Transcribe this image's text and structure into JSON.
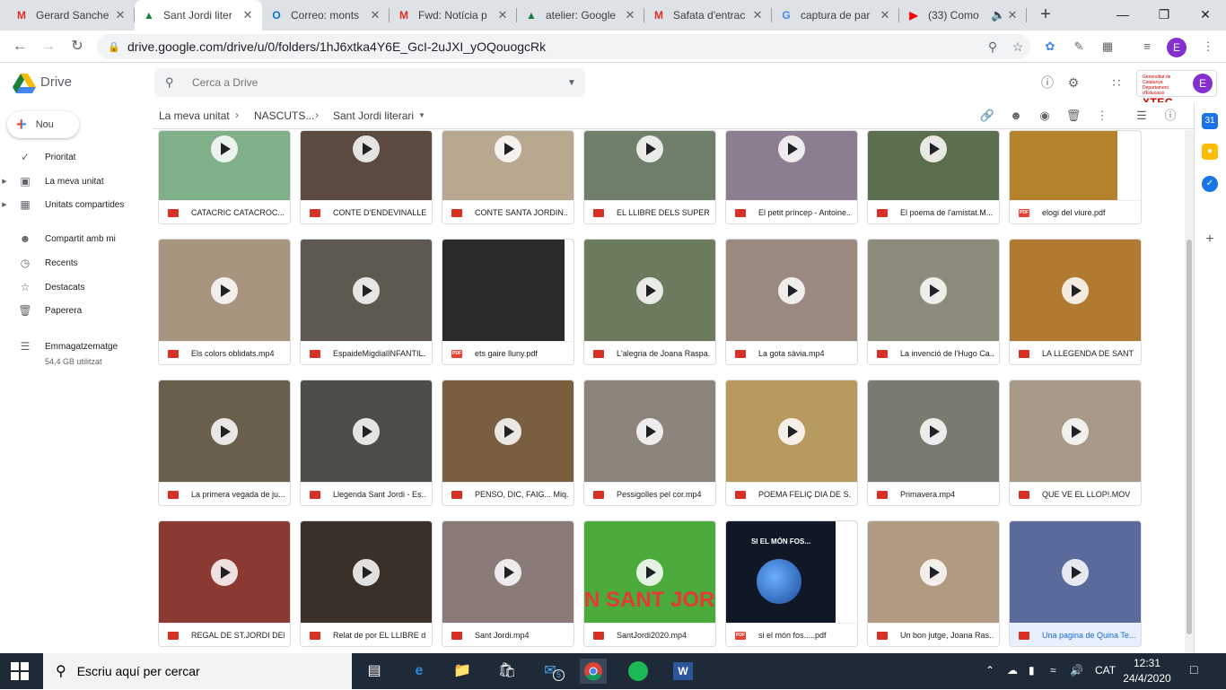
{
  "browser": {
    "tabs": [
      {
        "title": "Gerard Sanche",
        "icon": "gmail-icon",
        "color": "#d93025"
      },
      {
        "title": "Sant Jordi liter",
        "icon": "drive-icon",
        "color": "#188038",
        "active": true
      },
      {
        "title": "Correo: monts",
        "icon": "outlook-icon",
        "color": "#0078d4"
      },
      {
        "title": "Fwd: Notícia p",
        "icon": "gmail-icon",
        "color": "#d93025"
      },
      {
        "title": "atelier: Google",
        "icon": "drive-icon",
        "color": "#188038"
      },
      {
        "title": "Safata d'entrac",
        "icon": "gmail-icon",
        "color": "#d93025"
      },
      {
        "title": "captura de par",
        "icon": "google-icon",
        "color": "#4285f4"
      },
      {
        "title": "(33) Como",
        "icon": "youtube-icon",
        "color": "#ff0000"
      }
    ],
    "url": "drive.google.com/drive/u/0/folders/1hJ6xtka4Y6E_GcI-2uJXI_yOQouogcRk",
    "profile_initial": "E"
  },
  "drive": {
    "app_name": "Drive",
    "search_placeholder": "Cerca a Drive",
    "new_label": "Nou",
    "profile_initial": "E",
    "xtec_small": "Generalitat de Catalunya Departament d'Educació",
    "xtec_label": "XTEC",
    "nav": [
      {
        "label": "Prioritat",
        "icon": "check-circle-icon"
      },
      {
        "label": "La meva unitat",
        "icon": "my-drive-icon",
        "expandable": true
      },
      {
        "label": "Unitats compartides",
        "icon": "shared-drives-icon",
        "expandable": true
      },
      {
        "label": "Compartit amb mi",
        "icon": "people-icon"
      },
      {
        "label": "Recents",
        "icon": "clock-icon"
      },
      {
        "label": "Destacats",
        "icon": "star-icon"
      },
      {
        "label": "Paperera",
        "icon": "trash-icon"
      },
      {
        "label": "Emmagatzematge",
        "icon": "storage-icon"
      }
    ],
    "storage_used": "54,4 GB utilitzat",
    "breadcrumb": [
      "La meva unitat",
      "NASCUTS...",
      "Sant Jordi literari"
    ],
    "files": [
      {
        "name": "CATACRIC CATACROC....",
        "type": "video",
        "bg": "#7fb08a"
      },
      {
        "name": "CONTE D'ENDEVINALLES",
        "type": "video",
        "bg": "#5a4a40"
      },
      {
        "name": "CONTE SANTA JORDIN...",
        "type": "video",
        "bg": "#b9a890"
      },
      {
        "name": "EL LLIBRE DELS SUPER ...",
        "type": "video",
        "bg": "#6f7f6a"
      },
      {
        "name": "El petit príncep - Antoine...",
        "type": "video",
        "bg": "#8a7e90"
      },
      {
        "name": "El poema de l'amistat.M...",
        "type": "video",
        "bg": "#5b6e4e"
      },
      {
        "name": "elogi del viure.pdf",
        "type": "pdf",
        "bg": "#b4832c"
      },
      {
        "name": "Els colors oblidats.mp4",
        "type": "video",
        "bg": "#a89580"
      },
      {
        "name": "EspaideMigdialINFANTIL...",
        "type": "video",
        "bg": "#5e5a52"
      },
      {
        "name": "ets gaire lluny.pdf",
        "type": "pdf",
        "bg": "#2a2a2a"
      },
      {
        "name": "L'alegria de Joana Raspa...",
        "type": "video",
        "bg": "#6c7a5e"
      },
      {
        "name": "La gota sàvia.mp4",
        "type": "video",
        "bg": "#9a8a80"
      },
      {
        "name": "La invenció de l'Hugo Ca...",
        "type": "video",
        "bg": "#8c8a7a"
      },
      {
        "name": "LA LLEGENDA DE SANT ...",
        "type": "video",
        "bg": "#b07a30"
      },
      {
        "name": "La primera vegada de ju...",
        "type": "video",
        "bg": "#6a5e4c"
      },
      {
        "name": "Llegenda Sant Jordi - Es...",
        "type": "video",
        "bg": "#4a4e46"
      },
      {
        "name": "PENSO, DIC, FAIG... Miq...",
        "type": "video",
        "bg": "#7a5e40"
      },
      {
        "name": "Pessigolles pel cor.mp4",
        "type": "video",
        "bg": "#8a847a"
      },
      {
        "name": "POEMA FELIÇ DIA DE S...",
        "type": "video",
        "bg": "#b89a60"
      },
      {
        "name": "Primavera.mp4",
        "type": "video",
        "bg": "#7a7a70"
      },
      {
        "name": "QUE VE EL LLOP!.MOV",
        "type": "video",
        "bg": "#a89a88"
      },
      {
        "name": "REGAL DE ST.JORDI DEL...",
        "type": "video",
        "bg": "#8a3a30"
      },
      {
        "name": "Relat de por EL LLIBRE d...",
        "type": "video",
        "bg": "#3a302a"
      },
      {
        "name": "Sant Jordi.mp4",
        "type": "video",
        "bg": "#8a7a78"
      },
      {
        "name": "SantJordi2020.mp4",
        "type": "video",
        "bg": "#4aaa3a"
      },
      {
        "name": "si el món fos.....pdf",
        "type": "pdf",
        "bg": "#101828"
      },
      {
        "name": "Un bon jutge, Joana Ras...",
        "type": "video",
        "bg": "#b09a80"
      },
      {
        "name": "Una pagina de Quina Te...",
        "type": "video",
        "bg": "#5a6a9a",
        "selected": true
      }
    ],
    "thumb_texts": {
      "santjordi": "N SANT JORD",
      "simonfos": "SI EL MÓN FOS..."
    }
  },
  "taskbar": {
    "search_placeholder": "Escriu aquí per cercar",
    "lang": "CAT",
    "time": "12:31",
    "date": "24/4/2020",
    "mail_badge": "5"
  }
}
